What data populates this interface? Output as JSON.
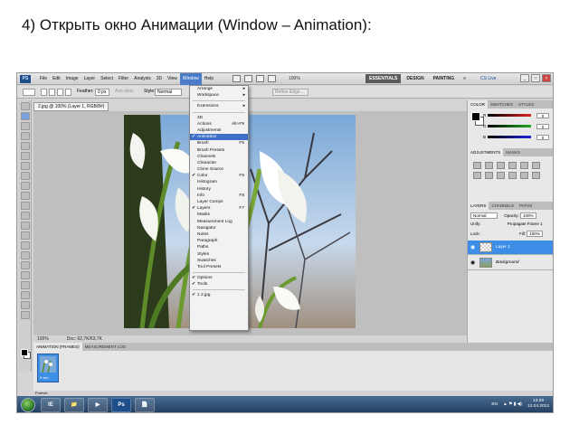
{
  "slide_title": "4) Открыть окно Анимации (Window – Animation):",
  "menubar": {
    "logo": "PS",
    "items": [
      "File",
      "Edit",
      "Image",
      "Layer",
      "Select",
      "Filter",
      "Analysis",
      "3D",
      "View",
      "Window",
      "Help"
    ],
    "active_item": "Window",
    "zoom": "100%",
    "workspaces": [
      "ESSENTIALS",
      "DESIGN",
      "PAINTING",
      "»"
    ],
    "cs_live": "CS Live"
  },
  "options_bar": {
    "feather_label": "Feather:",
    "feather_value": "0 px",
    "anti_alias": "Anti-alias",
    "style_label": "Style:",
    "style_value": "Normal",
    "refine_edge": "Refine Edge..."
  },
  "document": {
    "tab_title": "2.jpg @ 100% (Layer 1, RGB/8#)",
    "status_zoom": "100%",
    "status_doc": "Doc: 62,7K/63,7K"
  },
  "window_menu": {
    "items": [
      {
        "label": "Arrange",
        "submenu": true
      },
      {
        "label": "Workspace",
        "submenu": true
      },
      {
        "sep": true
      },
      {
        "label": "Extensions",
        "submenu": true
      },
      {
        "sep": true
      },
      {
        "label": "3D"
      },
      {
        "label": "Actions",
        "shortcut": "Alt+F9"
      },
      {
        "label": "Adjustments"
      },
      {
        "label": "Animation",
        "checked": true,
        "highlight": true
      },
      {
        "label": "Brush",
        "shortcut": "F5"
      },
      {
        "label": "Brush Presets"
      },
      {
        "label": "Channels"
      },
      {
        "label": "Character"
      },
      {
        "label": "Clone Source"
      },
      {
        "label": "Color",
        "shortcut": "F6",
        "checked": true
      },
      {
        "label": "Histogram"
      },
      {
        "label": "History"
      },
      {
        "label": "Info",
        "shortcut": "F8"
      },
      {
        "label": "Layer Comps"
      },
      {
        "label": "Layers",
        "shortcut": "F7",
        "checked": true
      },
      {
        "label": "Masks"
      },
      {
        "label": "Measurement Log"
      },
      {
        "label": "Navigator"
      },
      {
        "label": "Notes"
      },
      {
        "label": "Paragraph"
      },
      {
        "label": "Paths"
      },
      {
        "label": "Styles"
      },
      {
        "label": "Swatches"
      },
      {
        "label": "Tool Presets"
      },
      {
        "sep": true
      },
      {
        "label": "Options",
        "checked": true
      },
      {
        "label": "Tools",
        "checked": true
      },
      {
        "sep": true
      },
      {
        "label": "1 2.jpg",
        "checked": true
      }
    ]
  },
  "color_panel": {
    "tabs": [
      "COLOR",
      "SWATCHES",
      "STYLES"
    ],
    "channels": [
      {
        "label": "R",
        "value": "0",
        "color": "#d22"
      },
      {
        "label": "G",
        "value": "0",
        "color": "#2a2"
      },
      {
        "label": "B",
        "value": "0",
        "color": "#22d"
      }
    ]
  },
  "adjustments_panel": {
    "tabs": [
      "ADJUSTMENTS",
      "MASKS"
    ]
  },
  "layers_panel": {
    "tabs": [
      "LAYERS",
      "CHANNELS",
      "PATHS"
    ],
    "blend_mode": "Normal",
    "opacity_label": "Opacity:",
    "opacity_value": "100%",
    "unify_label": "Unify:",
    "propagate_label": "Propagate Frame 1",
    "lock_label": "Lock:",
    "fill_label": "Fill:",
    "fill_value": "100%",
    "layers": [
      {
        "name": "Layer 1",
        "selected": true
      },
      {
        "name": "Background",
        "selected": false
      }
    ]
  },
  "animation_panel": {
    "tabs": [
      "ANIMATION (FRAMES)",
      "MEASUREMENT LOG"
    ],
    "frame_number": "1",
    "frame_delay": "0 sec.",
    "loop": "Forever"
  },
  "taskbar": {
    "apps": [
      "IE",
      "📁",
      "▶",
      "Ps",
      "📄"
    ],
    "lang": "EN",
    "time": "13:29",
    "date": "12.04.2012"
  }
}
